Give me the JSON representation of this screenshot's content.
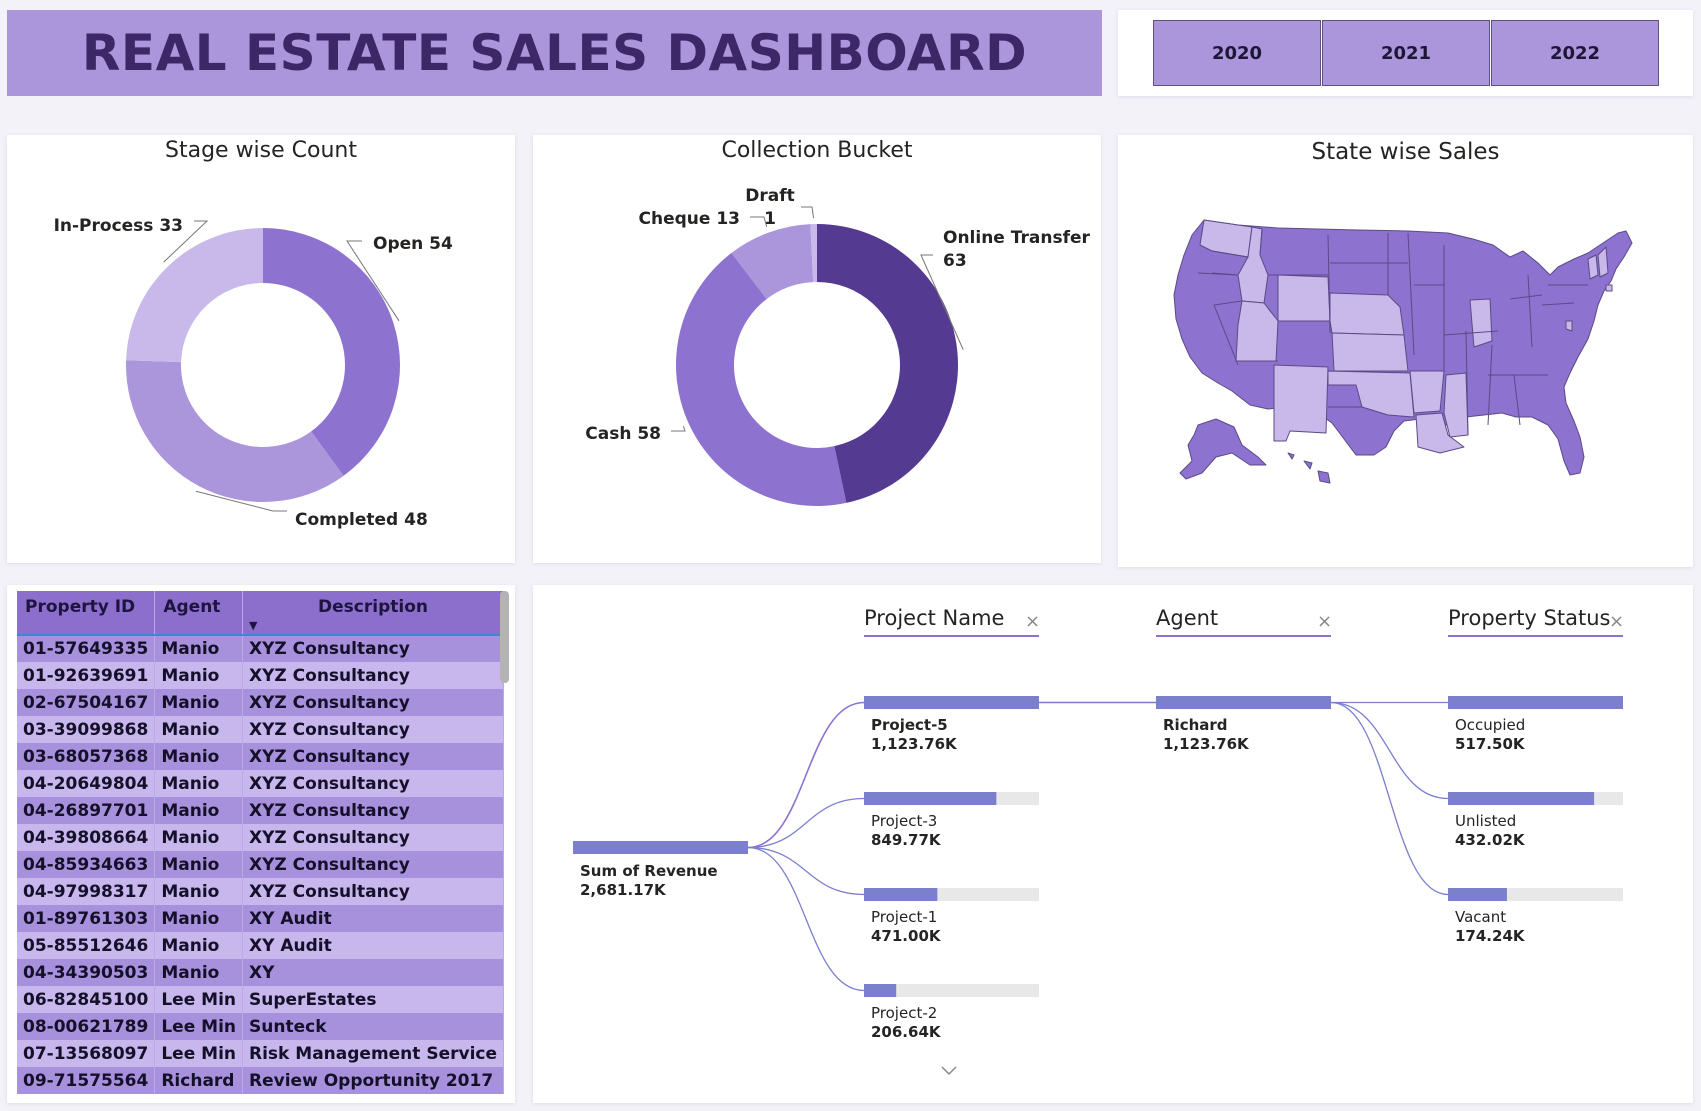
{
  "header": {
    "title": "REAL ESTATE SALES DASHBOARD"
  },
  "years": [
    {
      "label": "2020"
    },
    {
      "label": "2021"
    },
    {
      "label": "2022"
    }
  ],
  "colors": {
    "title_bg": "#ab96dc",
    "title_text": "#3d2766",
    "light": "#c9b9ea",
    "mid": "#ab96dc",
    "strong": "#8d72cf",
    "dark": "#553a91",
    "bar": "#7b7fcc",
    "bar_track": "#e8e8e8"
  },
  "chart_data": [
    {
      "type": "pie",
      "title": "Stage wise Count",
      "donut": true,
      "slices": [
        {
          "label": "Open",
          "value": 54,
          "color": "#8d72cf"
        },
        {
          "label": "Completed",
          "value": 48,
          "color": "#ab96dc"
        },
        {
          "label": "In-Process",
          "value": 33,
          "color": "#c9b9ea"
        }
      ]
    },
    {
      "type": "pie",
      "title": "Collection Bucket",
      "donut": true,
      "slices": [
        {
          "label": "Online Transfer",
          "value": 63,
          "color": "#553a91"
        },
        {
          "label": "Cash",
          "value": 58,
          "color": "#8d72cf"
        },
        {
          "label": "Cheque",
          "value": 13,
          "color": "#ab96dc"
        },
        {
          "label": "Draft",
          "value": 1,
          "color": "#c9b9ea"
        }
      ]
    },
    {
      "type": "other",
      "title": "State wise Sales",
      "legend": "none"
    },
    {
      "type": "table",
      "columns": [
        "Property ID",
        "Agent",
        "Description"
      ],
      "sort_column": "Description",
      "rows": [
        [
          "01-57649335",
          "Manio",
          "XYZ Consultancy"
        ],
        [
          "01-92639691",
          "Manio",
          "XYZ Consultancy"
        ],
        [
          "02-67504167",
          "Manio",
          "XYZ Consultancy"
        ],
        [
          "03-39099868",
          "Manio",
          "XYZ Consultancy"
        ],
        [
          "03-68057368",
          "Manio",
          "XYZ Consultancy"
        ],
        [
          "04-20649804",
          "Manio",
          "XYZ Consultancy"
        ],
        [
          "04-26897701",
          "Manio",
          "XYZ Consultancy"
        ],
        [
          "04-39808664",
          "Manio",
          "XYZ Consultancy"
        ],
        [
          "04-85934663",
          "Manio",
          "XYZ Consultancy"
        ],
        [
          "04-97998317",
          "Manio",
          "XYZ Consultancy"
        ],
        [
          "01-89761303",
          "Manio",
          "XY Audit"
        ],
        [
          "05-85512646",
          "Manio",
          "XY Audit"
        ],
        [
          "04-34390503",
          "Manio",
          "XY"
        ],
        [
          "06-82845100",
          "Lee Min",
          "SuperEstates"
        ],
        [
          "08-00621789",
          "Lee Min",
          "Sunteck"
        ],
        [
          "07-13568097",
          "Lee Min",
          "Risk Management Service"
        ],
        [
          "09-71575564",
          "Richard",
          "Review Opportunity 2017"
        ]
      ]
    },
    {
      "type": "bar",
      "subtype": "decomposition-tree",
      "root": {
        "label": "Sum of Revenue",
        "value_label": "2,681.17K",
        "value": 2681.17
      },
      "levels": [
        {
          "header": "Project Name",
          "nodes": [
            {
              "label": "Project-5",
              "value_label": "1,123.76K",
              "value": 1123.76,
              "selected": true
            },
            {
              "label": "Project-3",
              "value_label": "849.77K",
              "value": 849.77,
              "selected": false
            },
            {
              "label": "Project-1",
              "value_label": "471.00K",
              "value": 471.0,
              "selected": false
            },
            {
              "label": "Project-2",
              "value_label": "206.64K",
              "value": 206.64,
              "selected": false
            }
          ]
        },
        {
          "header": "Agent",
          "nodes": [
            {
              "label": "Richard",
              "value_label": "1,123.76K",
              "value": 1123.76,
              "selected": true
            }
          ]
        },
        {
          "header": "Property Status",
          "nodes": [
            {
              "label": "Occupied",
              "value_label": "517.50K",
              "value": 517.5,
              "selected": false
            },
            {
              "label": "Unlisted",
              "value_label": "432.02K",
              "value": 432.02,
              "selected": false
            },
            {
              "label": "Vacant",
              "value_label": "174.24K",
              "value": 174.24,
              "selected": false
            }
          ]
        }
      ]
    }
  ]
}
